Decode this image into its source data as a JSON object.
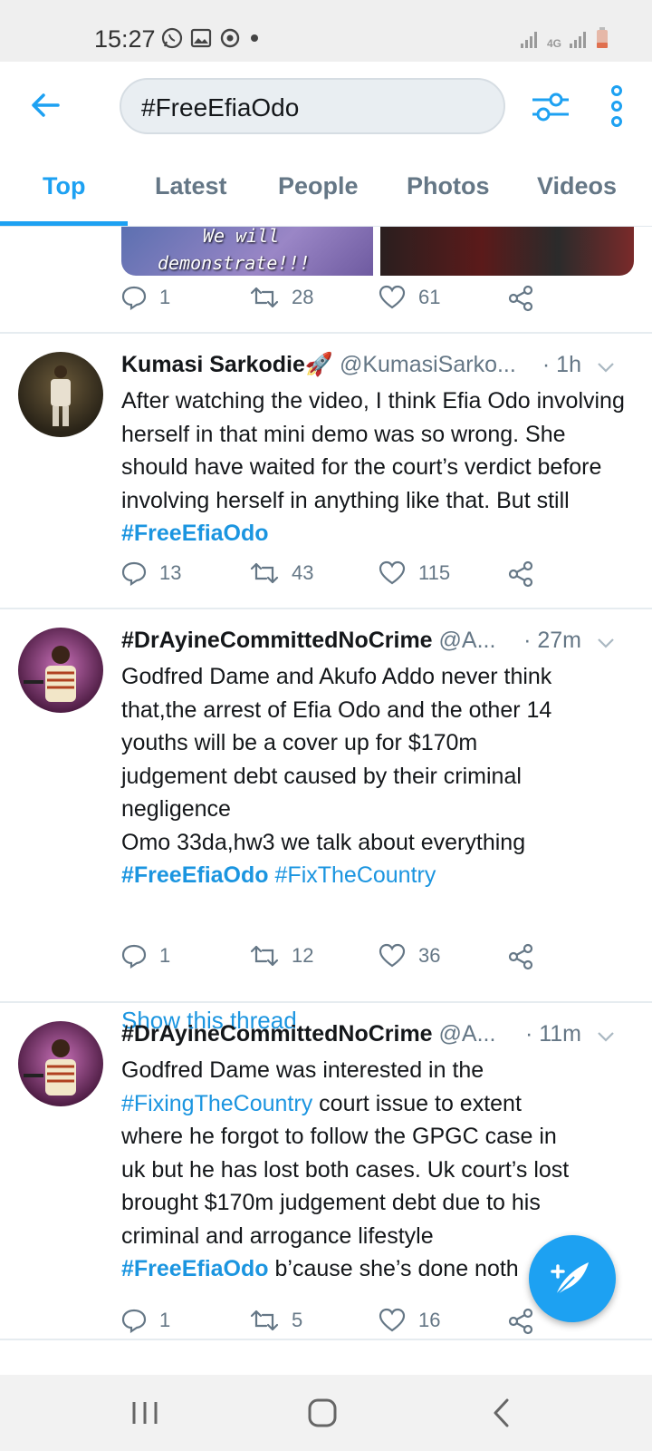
{
  "status_bar": {
    "time": "15:27",
    "network": "4G",
    "icons": [
      "whatsapp-icon",
      "gallery-icon",
      "sync-icon",
      "dot-icon",
      "signal-icon",
      "battery-icon"
    ]
  },
  "header": {
    "search_query": "#FreeEfiaOdo",
    "back_icon": "arrow-left-icon",
    "filter_icon": "filter-sliders-icon",
    "more_icon": "more-vertical-icon"
  },
  "tabs": [
    {
      "label": "Top",
      "active": true
    },
    {
      "label": "Latest",
      "active": false
    },
    {
      "label": "People",
      "active": false
    },
    {
      "label": "Photos",
      "active": false
    },
    {
      "label": "Videos",
      "active": false
    }
  ],
  "tweet0": {
    "media_caption_1": "We will",
    "media_caption_2": "demonstrate!!!",
    "replies": "1",
    "retweets": "28",
    "likes": "61"
  },
  "tweet1": {
    "name": "Kumasi Sarkodie🚀",
    "handle": "@KumasiSarko...",
    "time": "· 1h",
    "body": "After watching the video, I think Efia Odo involving herself in that mini demo was so wrong. She should have waited for the court’s verdict before involving herself in anything like that. But still ",
    "hashtag": "#FreeEfiaOdo",
    "replies": "13",
    "retweets": "43",
    "likes": "115"
  },
  "tweet2": {
    "name": "#DrAyineCommittedNoCrime",
    "handle": "@A...",
    "time": "· 27m",
    "body_lines": [
      "Godfred Dame and Akufo Addo never think",
      "that,the arrest of Efia Odo and the other 14",
      "youths will be a cover up for $170m",
      "judgement debt caused by their criminal",
      "negligence",
      "Omo 33da,hw3 we talk about everything"
    ],
    "hashtag_1": "#FreeEfiaOdo",
    "hashtag_2": "#FixTheCountry",
    "replies": "1",
    "retweets": "12",
    "likes": "36",
    "thread_link": "Show this thread"
  },
  "tweet3": {
    "name": "#DrAyineCommittedNoCrime",
    "handle": "@A...",
    "time": "· 11m",
    "body_line_1": "Godfred Dame was  interested in the",
    "hashtag_1": "#FixingTheCountry",
    "body_line_2_rest": " court issue to extent",
    "body_lines": [
      "where he forgot to follow the GPGC case in",
      "uk but he has lost both cases. Uk court’s lost",
      "brought $170m judgement debt due to his",
      "criminal and arrogance lifestyle"
    ],
    "hashtag_2": "#FreeEfiaOdo",
    "body_last": " b’cause she’s done noth",
    "replies": "1",
    "retweets": "5",
    "likes": "16"
  },
  "colors": {
    "accent": "#1da1f2",
    "link": "#1b95e0",
    "muted": "#657786",
    "text": "#14171a"
  }
}
